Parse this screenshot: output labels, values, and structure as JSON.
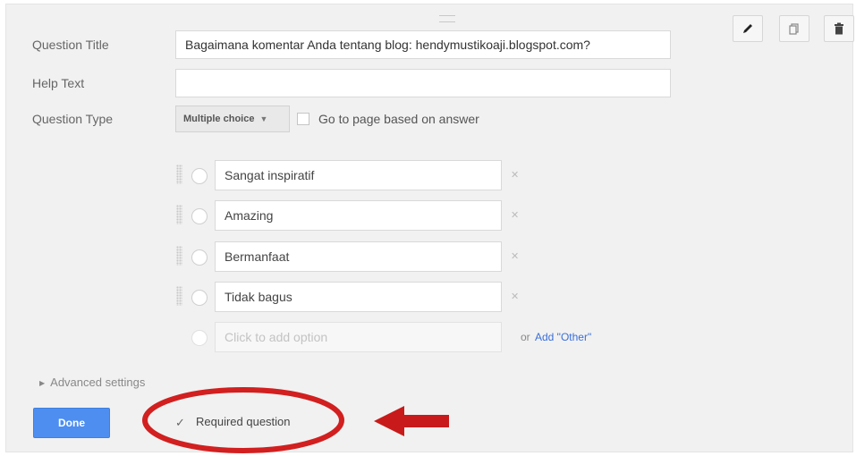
{
  "form": {
    "question_title_label": "Question Title",
    "question_title_value": "Bagaimana komentar Anda tentang blog: hendymustikoaji.blogspot.com?",
    "help_text_label": "Help Text",
    "help_text_value": "",
    "question_type_label": "Question Type",
    "question_type_value": "Multiple choice",
    "go_to_page_label": "Go to page based on answer",
    "go_to_page_checked": false
  },
  "options": [
    {
      "label": "Sangat inspiratif"
    },
    {
      "label": "Amazing"
    },
    {
      "label": "Bermanfaat"
    },
    {
      "label": "Tidak bagus"
    }
  ],
  "add_option": {
    "placeholder": "Click to add option",
    "or_text": "or",
    "add_other_link": "Add \"Other\""
  },
  "advanced_settings_label": "Advanced settings",
  "done_label": "Done",
  "required": {
    "label": "Required question",
    "checked": true
  },
  "toolbar": {
    "edit_icon": "pencil-icon",
    "duplicate_icon": "duplicate-icon",
    "delete_icon": "trash-icon"
  },
  "colors": {
    "accent_blue": "#4d8ef0",
    "annotation_red": "#d21f1f",
    "link_blue": "#3a6fd8"
  }
}
